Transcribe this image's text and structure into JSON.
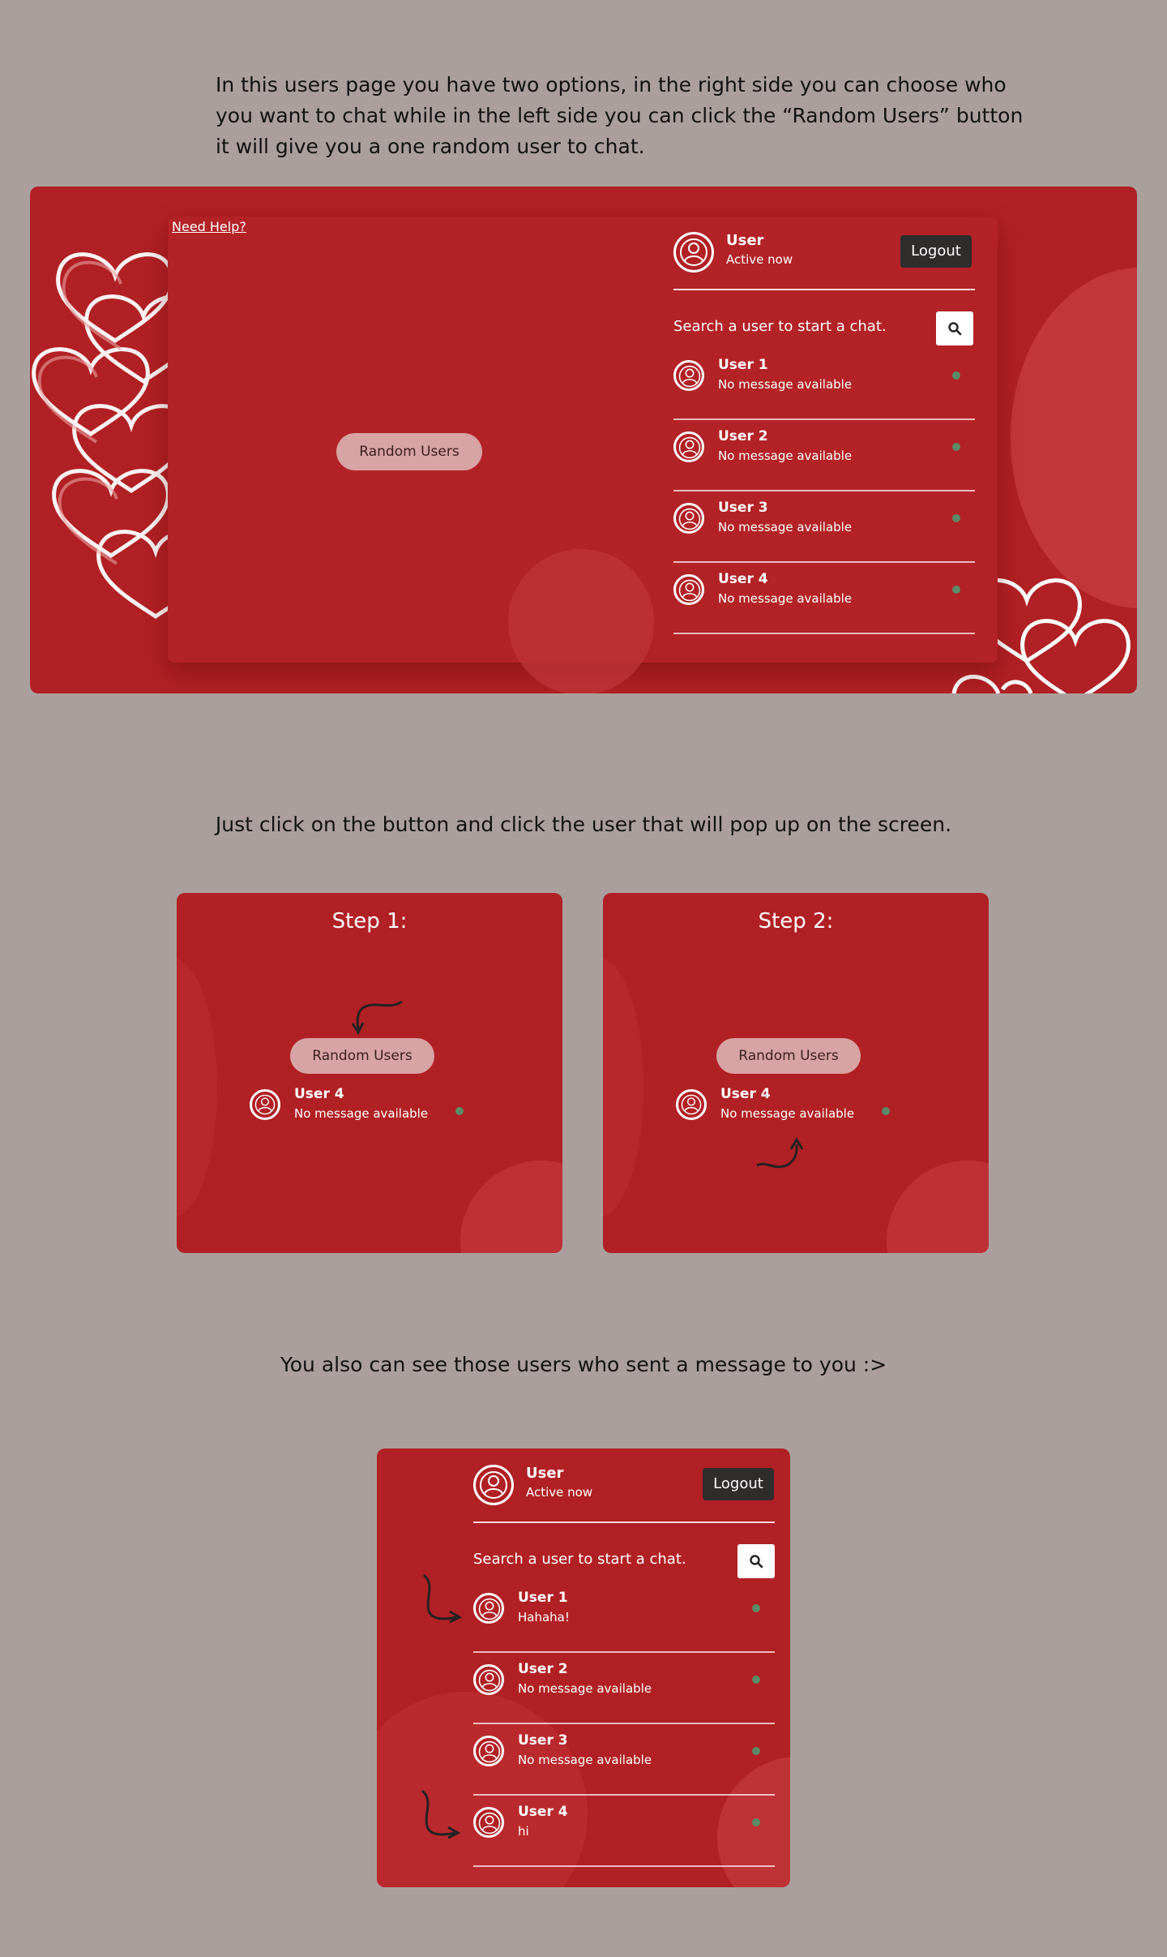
{
  "captions": {
    "intro": "In this users page you have two options, in the right side you can choose who you want to chat while in the left side you can click the “Random Users” button it will give you a one random user to chat.",
    "step_intro": "Just click on the button and click the user that will pop up on the screen.",
    "messages_intro": "You also can see those users who sent a message to you :>"
  },
  "hero": {
    "help_link": "Need Help?",
    "random_button": "Random Users",
    "header": {
      "name": "User",
      "status": "Active now",
      "logout": "Logout"
    },
    "search_placeholder": "Search a user to start a chat.",
    "users": [
      {
        "name": "User 1",
        "message": "No message available"
      },
      {
        "name": "User 2",
        "message": "No message available"
      },
      {
        "name": "User 3",
        "message": "No message available"
      },
      {
        "name": "User 4",
        "message": "No message available"
      }
    ]
  },
  "steps": [
    {
      "title": "Step 1:",
      "button": "Random Users",
      "user": {
        "name": "User 4",
        "message": "No message available"
      }
    },
    {
      "title": "Step 2:",
      "button": "Random Users",
      "user": {
        "name": "User 4",
        "message": "No message available"
      }
    }
  ],
  "messages_panel": {
    "header": {
      "name": "User",
      "status": "Active now",
      "logout": "Logout"
    },
    "search_placeholder": "Search a user to start a chat.",
    "users": [
      {
        "name": "User 1",
        "message": "Hahaha!"
      },
      {
        "name": "User 2",
        "message": "No message available"
      },
      {
        "name": "User 3",
        "message": "No message available"
      },
      {
        "name": "User 4",
        "message": "hi"
      }
    ]
  },
  "colors": {
    "background": "#ab9f9e",
    "red": "#b12024",
    "online": "#5c8a66",
    "logout": "#2f2c2c",
    "button": "#d8a3a3"
  },
  "icons": [
    "user-avatar-icon",
    "search-icon",
    "heart-outline-icon",
    "curved-arrow-icon",
    "online-dot-icon"
  ]
}
